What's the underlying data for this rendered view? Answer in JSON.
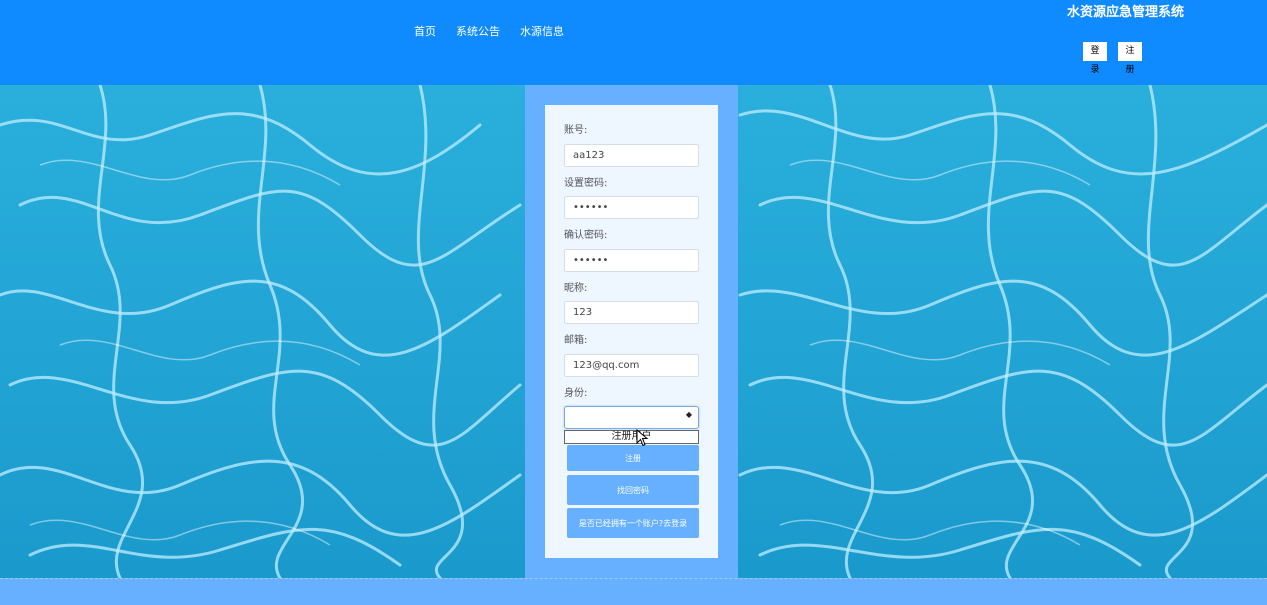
{
  "header": {
    "nav": [
      "首页",
      "系统公告",
      "水源信息"
    ],
    "title": "水资源应急管理系统",
    "login_label": "登录",
    "register_label": "注册"
  },
  "form": {
    "account_label": "账号:",
    "account_value": "aa123",
    "password_label": "设置密码:",
    "password_value": "••••••",
    "confirm_label": "确认密码:",
    "confirm_value": "••••••",
    "nickname_label": "昵称:",
    "nickname_value": "123",
    "email_label": "邮箱:",
    "email_value": "123@qq.com",
    "identity_label": "身份:",
    "identity_value": "",
    "identity_options": [
      "注册用户"
    ],
    "register_button": "注册",
    "recover_button": "找回密码",
    "login_link_button": "是否已经拥有一个账户?去登录"
  },
  "colors": {
    "header_bg": "#0f8bff",
    "panel_bg": "#66b0ff",
    "card_bg": "#eef6ff",
    "water": "#1ea6d6"
  }
}
